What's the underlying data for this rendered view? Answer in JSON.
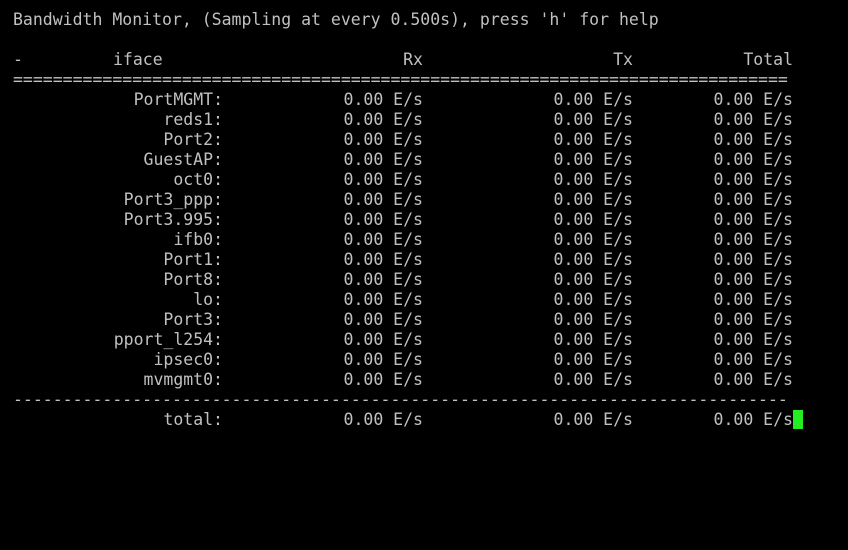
{
  "header": {
    "title": "Bandwidth Monitor, (Sampling at every 0.500s), press 'h' for help"
  },
  "columns": {
    "marker": "-",
    "iface": "iface",
    "rx": "Rx",
    "tx": "Tx",
    "total": "Total"
  },
  "separators": {
    "double": "==============================================================================",
    "single": "------------------------------------------------------------------------------"
  },
  "rows": [
    {
      "iface": "PortMGMT:",
      "rx": "0.00 E/s",
      "tx": "0.00 E/s",
      "total": "0.00 E/s"
    },
    {
      "iface": "reds1:",
      "rx": "0.00 E/s",
      "tx": "0.00 E/s",
      "total": "0.00 E/s"
    },
    {
      "iface": "Port2:",
      "rx": "0.00 E/s",
      "tx": "0.00 E/s",
      "total": "0.00 E/s"
    },
    {
      "iface": "GuestAP:",
      "rx": "0.00 E/s",
      "tx": "0.00 E/s",
      "total": "0.00 E/s"
    },
    {
      "iface": "oct0:",
      "rx": "0.00 E/s",
      "tx": "0.00 E/s",
      "total": "0.00 E/s"
    },
    {
      "iface": "Port3_ppp:",
      "rx": "0.00 E/s",
      "tx": "0.00 E/s",
      "total": "0.00 E/s"
    },
    {
      "iface": "Port3.995:",
      "rx": "0.00 E/s",
      "tx": "0.00 E/s",
      "total": "0.00 E/s"
    },
    {
      "iface": "ifb0:",
      "rx": "0.00 E/s",
      "tx": "0.00 E/s",
      "total": "0.00 E/s"
    },
    {
      "iface": "Port1:",
      "rx": "0.00 E/s",
      "tx": "0.00 E/s",
      "total": "0.00 E/s"
    },
    {
      "iface": "Port8:",
      "rx": "0.00 E/s",
      "tx": "0.00 E/s",
      "total": "0.00 E/s"
    },
    {
      "iface": "lo:",
      "rx": "0.00 E/s",
      "tx": "0.00 E/s",
      "total": "0.00 E/s"
    },
    {
      "iface": "Port3:",
      "rx": "0.00 E/s",
      "tx": "0.00 E/s",
      "total": "0.00 E/s"
    },
    {
      "iface": "pport_l254:",
      "rx": "0.00 E/s",
      "tx": "0.00 E/s",
      "total": "0.00 E/s"
    },
    {
      "iface": "ipsec0:",
      "rx": "0.00 E/s",
      "tx": "0.00 E/s",
      "total": "0.00 E/s"
    },
    {
      "iface": "mvmgmt0:",
      "rx": "0.00 E/s",
      "tx": "0.00 E/s",
      "total": "0.00 E/s"
    }
  ],
  "footer": {
    "iface": "total:",
    "rx": "0.00 E/s",
    "tx": "0.00 E/s",
    "total": "0.00 E/s"
  },
  "colors": {
    "background": "#000000",
    "text": "#c0c0c0",
    "cursor": "#22ee22"
  }
}
